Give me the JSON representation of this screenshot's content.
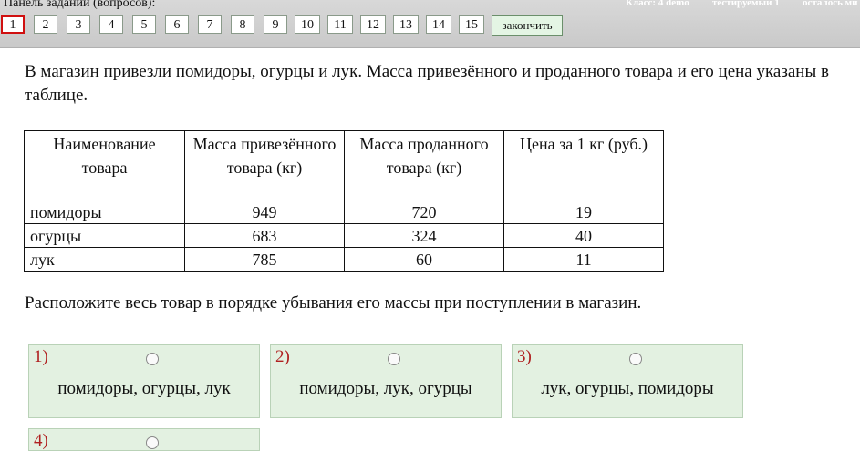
{
  "panel": {
    "title": "Панель заданий (вопросов):",
    "status_class": "Класс: 4 demo",
    "status_tested": "тестируемый 1",
    "status_left": "осталось ми"
  },
  "questions": [
    "1",
    "2",
    "3",
    "4",
    "5",
    "6",
    "7",
    "8",
    "9",
    "10",
    "11",
    "12",
    "13",
    "14",
    "15"
  ],
  "active_question": "1",
  "finish_label": "закончить",
  "question_text": "В магазин привезли помидоры, огурцы и лук. Масса привезённого и проданного товара и его цена указаны в таблице.",
  "table": {
    "headers": [
      "Наименование товара",
      "Масса привезённого товара (кг)",
      "Масса проданного товара (кг)",
      "Цена за 1 кг (руб.)"
    ],
    "rows": [
      [
        "помидоры",
        "949",
        "720",
        "19"
      ],
      [
        "огурцы",
        "683",
        "324",
        "40"
      ],
      [
        "лук",
        "785",
        "60",
        "11"
      ]
    ]
  },
  "instruction": "Расположите весь товар в порядке убывания его массы при поступлении в магазин.",
  "options": [
    {
      "number": "1)",
      "text": "помидоры, огурцы, лук"
    },
    {
      "number": "2)",
      "text": "помидоры, лук, огурцы"
    },
    {
      "number": "3)",
      "text": "лук, огурцы, помидоры"
    },
    {
      "number": "4)",
      "text": ""
    }
  ]
}
